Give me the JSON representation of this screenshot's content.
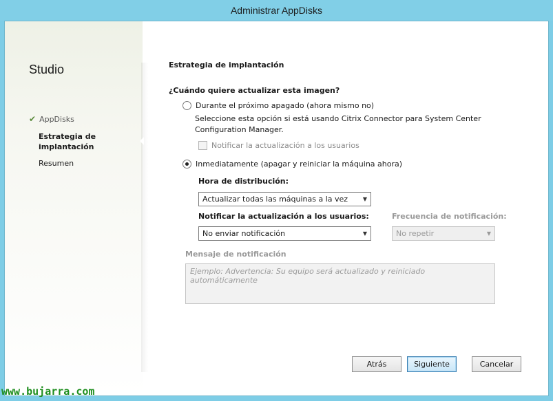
{
  "window": {
    "title": "Administrar AppDisks"
  },
  "sidebar": {
    "heading": "Studio",
    "steps": [
      {
        "label": "AppDisks",
        "state": "done"
      },
      {
        "label": "Estrategia de implantación",
        "state": "current"
      },
      {
        "label": "Resumen",
        "state": "pending"
      }
    ]
  },
  "main": {
    "title": "Estrategia de implantación",
    "question": "¿Cuándo quiere actualizar esta imagen?",
    "option_next_shutdown": {
      "label": "Durante el próximo apagado (ahora mismo no)",
      "description": "Seleccione esta opción si está usando Citrix Connector para System Center Configuration Manager.",
      "selected": false
    },
    "notify_checkbox": {
      "label": "Notificar la actualización a los usuarios",
      "checked": false,
      "enabled": false
    },
    "option_immediately": {
      "label": "Inmediatamente (apagar y reiniciar la máquina ahora)",
      "selected": true
    },
    "distribution_time": {
      "label": "Hora de distribución:",
      "value": "Actualizar todas las máquinas a la vez"
    },
    "notify_users": {
      "label": "Notificar la actualización a los usuarios:",
      "value": "No enviar notificación"
    },
    "notify_frequency": {
      "label": "Frecuencia de notificación:",
      "value": "No repetir"
    },
    "notification_message": {
      "label": "Mensaje de notificación",
      "placeholder": "Ejemplo: Advertencia: Su equipo será actualizado y reiniciado automáticamente"
    }
  },
  "footer": {
    "back_label": "Atrás",
    "next_label": "Siguiente",
    "cancel_label": "Cancelar"
  },
  "watermark": "www.bujarra.com",
  "colors": {
    "titlebar": "#81cfe7",
    "check": "#5a8a3a",
    "watermark": "#1e8e1e",
    "primary_border": "#3c7fb1"
  }
}
